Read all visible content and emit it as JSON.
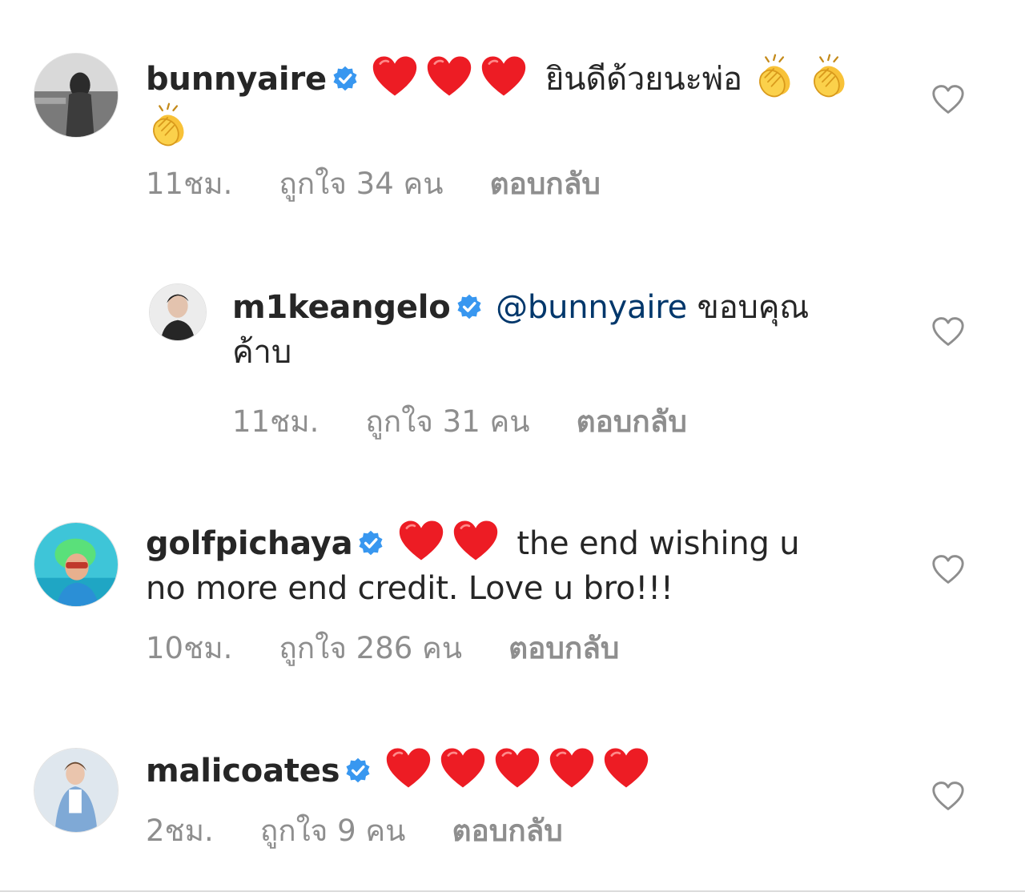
{
  "colors": {
    "verified": "#3897f0",
    "heart": "#ed1c24",
    "mention": "#00376b",
    "meta_text": "#8e8e8e"
  },
  "comments": [
    {
      "username": "bunnyaire",
      "verified": true,
      "text": "ยินดีด้วยนะพ่อ",
      "text_after_emoji_icons": [
        "red-heart-icon",
        "red-heart-icon",
        "red-heart-icon"
      ],
      "trailing_emoji_icons": [
        "clapping-hands-icon",
        "clapping-hands-icon",
        "clapping-hands-icon"
      ],
      "time": "11ชม.",
      "likes": "ถูกใจ 34 คน",
      "reply": "ตอบกลับ",
      "like_icon": "heart-outline-icon"
    },
    {
      "username": "m1keangelo",
      "verified": true,
      "mention": "@bunnyaire",
      "text_line1": "ขอบคุณ",
      "text_line2": "ค้าบ",
      "time": "11ชม.",
      "likes": "ถูกใจ 31 คน",
      "reply": "ตอบกลับ",
      "like_icon": "heart-outline-icon"
    },
    {
      "username": "golfpichaya",
      "verified": true,
      "emoji_icons": [
        "red-heart-icon",
        "red-heart-icon"
      ],
      "text_line1": "the end wishing u",
      "text_line2": "no more end credit. Love u bro!!!",
      "time": "10ชม.",
      "likes": "ถูกใจ 286 คน",
      "reply": "ตอบกลับ",
      "like_icon": "heart-outline-icon"
    },
    {
      "username": "malicoates",
      "verified": true,
      "emoji_icons": [
        "red-heart-icon",
        "red-heart-icon",
        "red-heart-icon",
        "red-heart-icon",
        "red-heart-icon"
      ],
      "time": "2ชม.",
      "likes": "ถูกใจ 9 คน",
      "reply": "ตอบกลับ",
      "like_icon": "heart-outline-icon"
    }
  ]
}
